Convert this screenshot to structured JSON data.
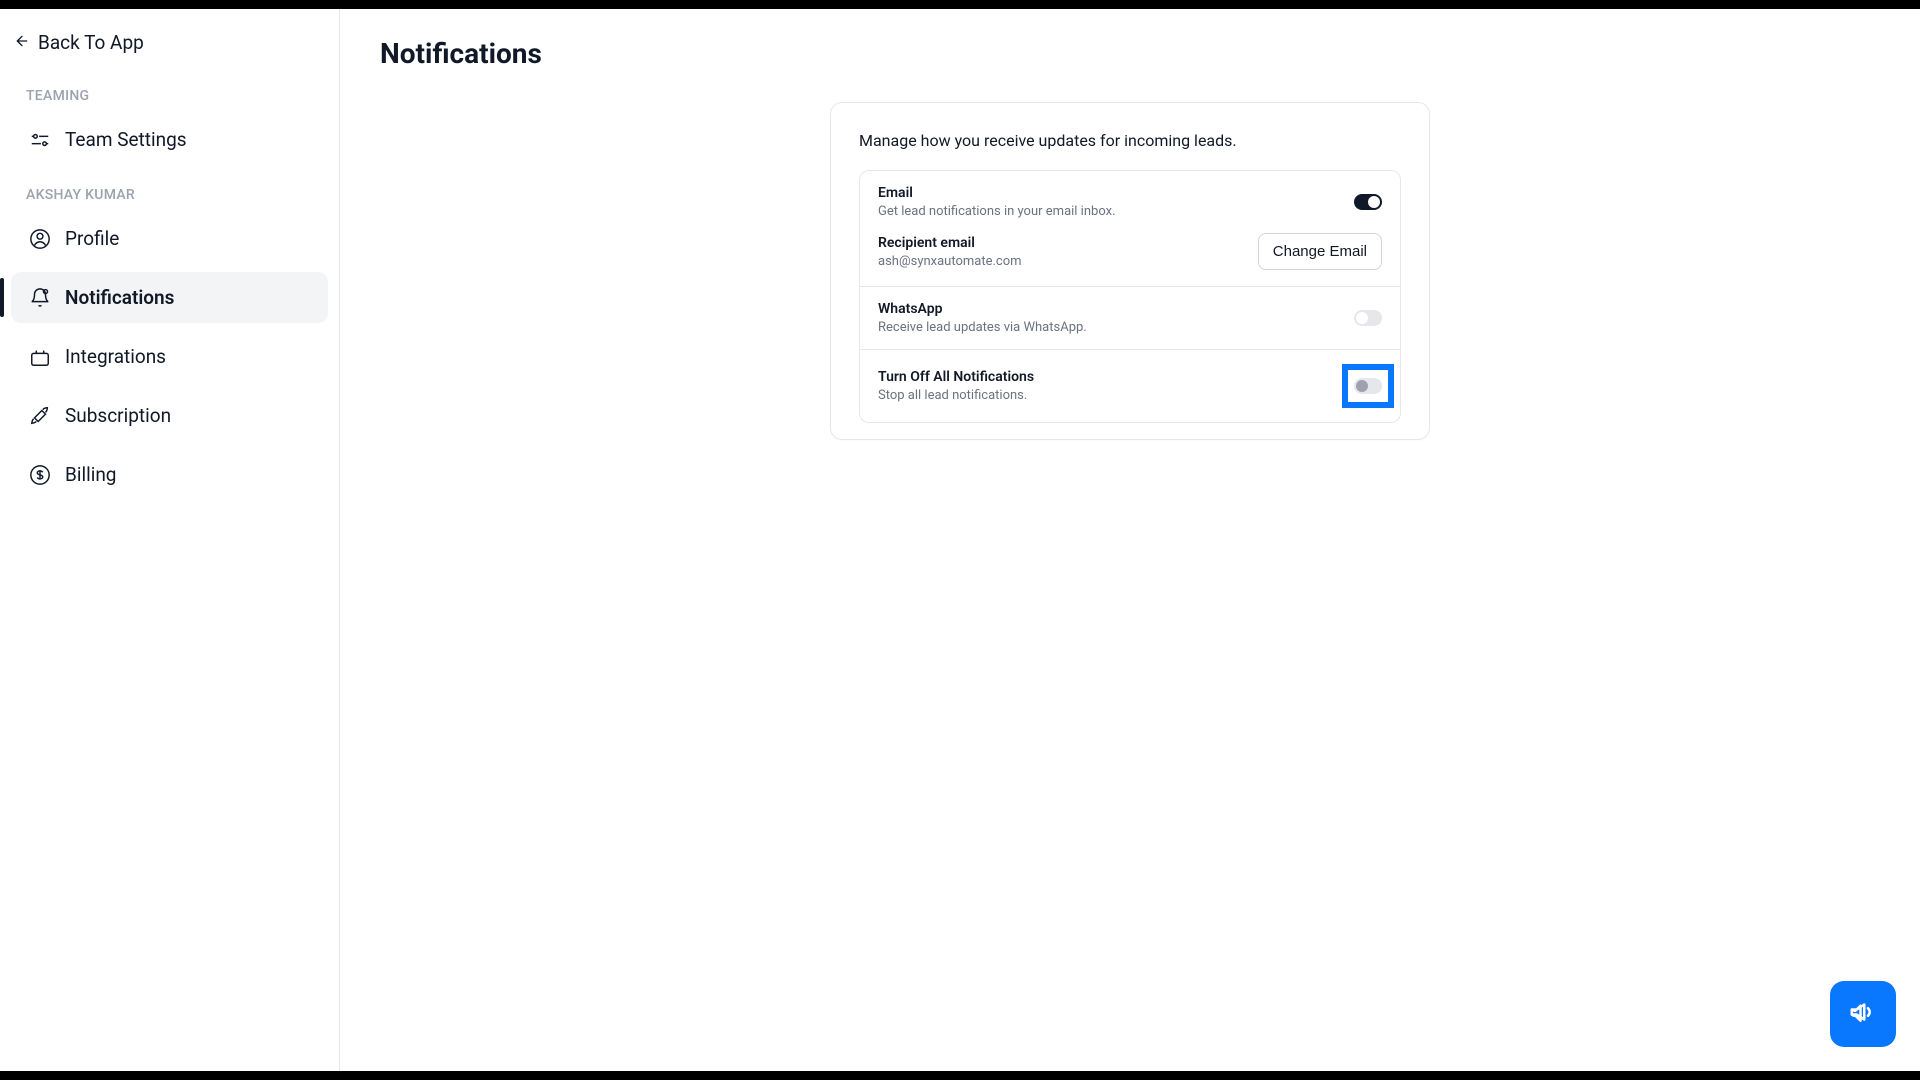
{
  "header": {
    "back_label": "Back To App"
  },
  "sidebar": {
    "section1_label": "TEAMING",
    "section1_items": [
      {
        "label": "Team Settings"
      }
    ],
    "section2_label": "AKSHAY KUMAR",
    "section2_items": [
      {
        "label": "Profile"
      },
      {
        "label": "Notifications"
      },
      {
        "label": "Integrations"
      },
      {
        "label": "Subscription"
      },
      {
        "label": "Billing"
      }
    ]
  },
  "page": {
    "title": "Notifications",
    "card_desc": "Manage how you receive updates for incoming leads.",
    "settings": {
      "email_title": "Email",
      "email_desc": "Get lead notifications in your email inbox.",
      "email_toggle": "on",
      "recipient_title": "Recipient email",
      "recipient_value": "ash@synxautomate.com",
      "change_email_label": "Change Email",
      "whatsapp_title": "WhatsApp",
      "whatsapp_desc": "Receive lead updates via WhatsApp.",
      "whatsapp_toggle": "off",
      "turnoff_title": "Turn Off All Notifications",
      "turnoff_desc": "Stop all lead notifications.",
      "turnoff_toggle": "off"
    }
  }
}
